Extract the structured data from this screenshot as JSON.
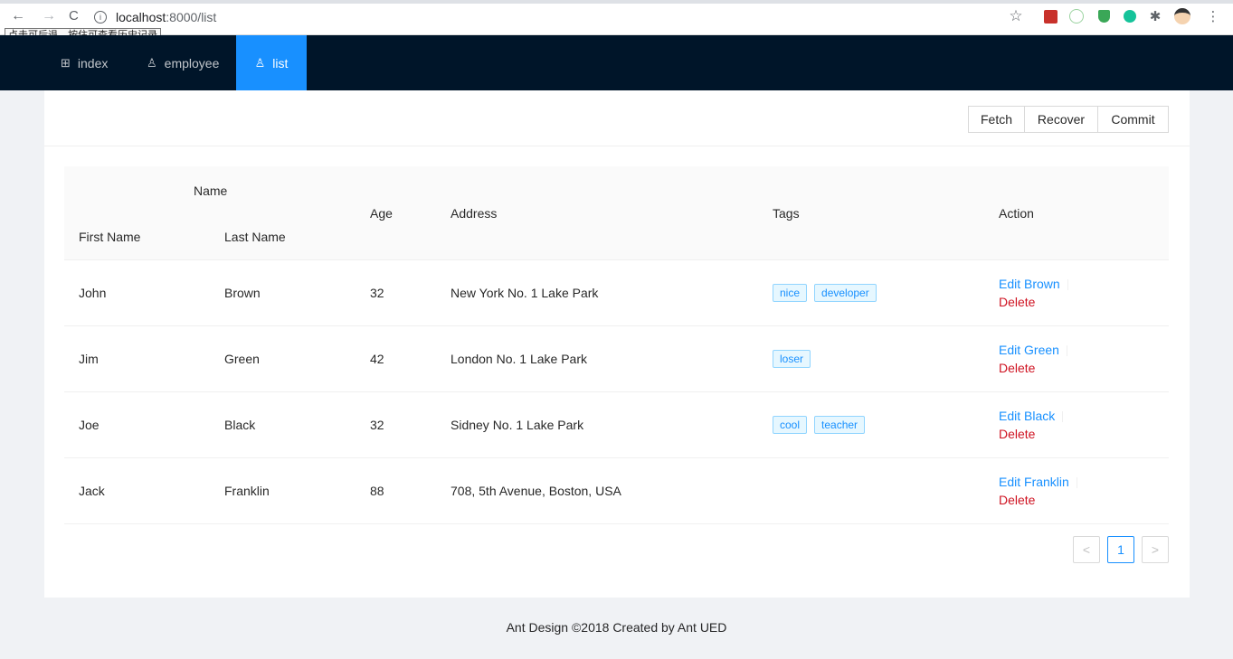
{
  "browser": {
    "back": "←",
    "forward": "→",
    "reload": "C",
    "url_host": "localhost",
    "url_path": ":8000/list",
    "tooltip": "点击可后退，按住可查看历史记录",
    "star": "☆",
    "menu": "⋮"
  },
  "header": {
    "menu": [
      {
        "label": "index",
        "icon": "appstore-icon",
        "glyph": "⊞"
      },
      {
        "label": "employee",
        "icon": "user-icon",
        "glyph": "♙"
      },
      {
        "label": "list",
        "icon": "team-icon",
        "glyph": "♙"
      }
    ],
    "active": "list",
    "bg_color": "#001529",
    "active_color": "#1890ff"
  },
  "toolbar": {
    "fetch_label": "Fetch",
    "recover_label": "Recover",
    "commit_label": "Commit"
  },
  "table": {
    "group_header": "Name",
    "columns": {
      "first_name": "First Name",
      "last_name": "Last Name",
      "age": "Age",
      "address": "Address",
      "tags": "Tags",
      "action": "Action"
    },
    "rows": [
      {
        "first": "John",
        "last": "Brown",
        "age": "32",
        "address": "New York No. 1 Lake Park",
        "tags": [
          "nice",
          "developer"
        ],
        "edit": "Edit Brown",
        "delete": "Delete"
      },
      {
        "first": "Jim",
        "last": "Green",
        "age": "42",
        "address": "London No. 1 Lake Park",
        "tags": [
          "loser"
        ],
        "edit": "Edit Green",
        "delete": "Delete"
      },
      {
        "first": "Joe",
        "last": "Black",
        "age": "32",
        "address": "Sidney No. 1 Lake Park",
        "tags": [
          "cool",
          "teacher"
        ],
        "edit": "Edit Black",
        "delete": "Delete"
      },
      {
        "first": "Jack",
        "last": "Franklin",
        "age": "88",
        "address": "708, 5th Avenue, Boston, USA",
        "tags": [],
        "edit": "Edit Franklin",
        "delete": "Delete"
      }
    ]
  },
  "pagination": {
    "prev": "<",
    "current": "1",
    "next": ">"
  },
  "footer": {
    "text": "Ant Design ©2018 Created by Ant UED"
  },
  "colors": {
    "link": "#1890ff",
    "danger": "#cf1322",
    "page_bg": "#f0f2f5"
  }
}
